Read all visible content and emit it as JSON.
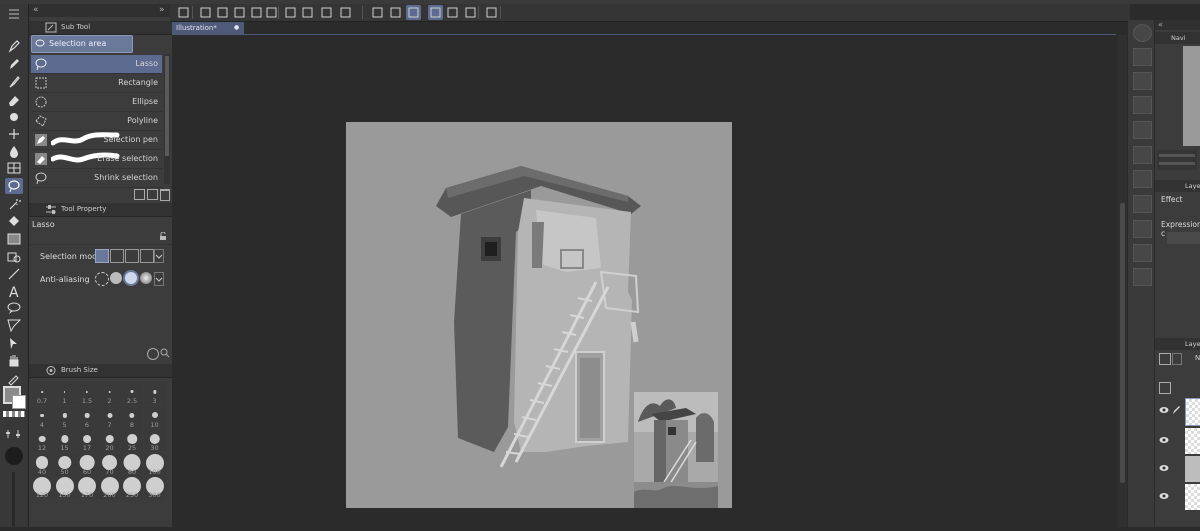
{
  "toolbar": {
    "icons": [
      "app-logo",
      "new-file",
      "open-file",
      "save-file",
      "undo",
      "redo",
      "clear",
      "fill-selection",
      "transform",
      "snap-off",
      "snap-2",
      "snap-3",
      "ruler-snap-1",
      "ruler-snap-2",
      "ruler-snap-3",
      "device-icon",
      "help-icon"
    ]
  },
  "subtool_panel": {
    "header": "Sub Tool",
    "group_tab": "Selection area",
    "items": [
      {
        "label": "Lasso",
        "icon": "lasso-icon",
        "selected": true
      },
      {
        "label": "Rectangle",
        "icon": "rectangle-select-icon",
        "selected": false
      },
      {
        "label": "Ellipse",
        "icon": "ellipse-select-icon",
        "selected": false
      },
      {
        "label": "Polyline",
        "icon": "polyline-select-icon",
        "selected": false
      },
      {
        "label": "Selection pen",
        "icon": "selection-pen-icon",
        "selected": false
      },
      {
        "label": "Erase selection",
        "icon": "erase-selection-icon",
        "selected": false
      },
      {
        "label": "Shrink selection",
        "icon": "shrink-selection-icon",
        "selected": false
      }
    ]
  },
  "tool_property": {
    "header": "Tool Property",
    "tool_name": "Lasso",
    "rows": [
      {
        "label": "Selection mode"
      },
      {
        "label": "Anti-aliasing"
      }
    ]
  },
  "brush_size": {
    "header": "Brush Size",
    "sizes": [
      "0.7",
      "1",
      "1.5",
      "2",
      "2.5",
      "3",
      "4",
      "5",
      "6",
      "7",
      "8",
      "10",
      "12",
      "15",
      "17",
      "20",
      "25",
      "30",
      "40",
      "50",
      "60",
      "70",
      "80",
      "100",
      "120",
      "150",
      "170",
      "200",
      "250",
      "300"
    ]
  },
  "document": {
    "tab_label": "Illustration*",
    "close_glyph": "●"
  },
  "right_panel": {
    "navigator_label": "Navi",
    "layer_prop_label": "Laye",
    "effect_label": "Effect",
    "expression_label": "Expression c",
    "layer_label": "Laye",
    "blend_short": "N"
  },
  "colors": {
    "accent": "#5c6b8f",
    "panel": "#3c3c3c",
    "canvas_bg": "#9a9a9a",
    "app_bg": "#2b2b2b"
  }
}
